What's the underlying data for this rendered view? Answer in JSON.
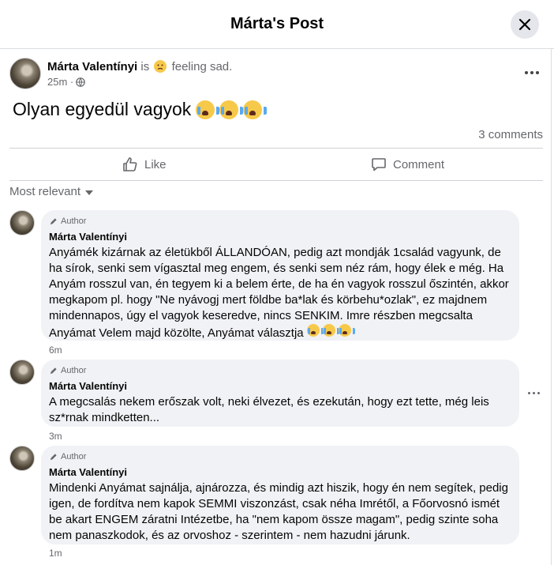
{
  "header": {
    "title": "Márta's Post"
  },
  "post": {
    "author": "Márta Valentínyi",
    "is_word": "is",
    "feeling_text": "feeling sad.",
    "time": "25m ·",
    "text": "Olyan egyedül vagyok",
    "comments_count": "3 comments"
  },
  "actions": {
    "like_label": "Like",
    "comment_label": "Comment"
  },
  "sort": {
    "label": "Most relevant"
  },
  "comments": [
    {
      "badge": "Author",
      "author": "Márta Valentínyi",
      "text": "Anyámék kizárnak az életükből ÁLLANDÓAN, pedig azt mondják 1család vagyunk, de ha sírok, senki sem vígasztal meg engem, és senki sem néz rám, hogy élek e még. Ha Anyám rosszul van, én tegyem ki a belem érte, de ha én vagyok rosszul őszintén, akkor megkapom pl. hogy \"Ne nyávogj mert földbe ba*lak és körbehu*ozlak\", ez majdnem mindennapos, úgy el vagyok keseredve, nincs SENKIM. Imre részben megcsalta Anyámat Velem majd közölte, Anyámat választja",
      "time": "6m"
    },
    {
      "badge": "Author",
      "author": "Márta Valentínyi",
      "text": "A megcsalás nekem erőszak volt, neki élvezet, és ezekután, hogy ezt tette, még leis sz*rnak mindketten...",
      "time": "3m"
    },
    {
      "badge": "Author",
      "author": "Márta Valentínyi",
      "text": "Mindenki Anyámat sajnálja, ajnározza, és mindig azt hiszik, hogy én nem segítek, pedig igen, de fordítva nem kapok SEMMI viszonzást, csak néha Imrétől, a Főorvosnó ismét be akart ENGEM záratni Intézetbe, ha \"nem kapom össze magam\", pedig szinte soha nem panaszkodok, és az orvoshoz - szerintem - nem hazudni járunk.",
      "time": "1m"
    }
  ],
  "colors": {
    "text": "#050505",
    "secondary": "#65676b",
    "bubble": "#f0f2f5",
    "divider": "#ced0d4"
  }
}
